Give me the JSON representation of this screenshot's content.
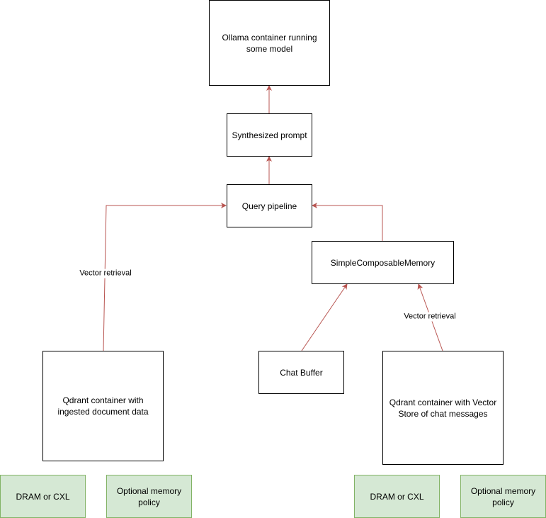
{
  "nodes": {
    "ollama": "Ollama container running some model",
    "synth": "Synthesized prompt",
    "query": "Query pipeline",
    "memory": "SimpleComposableMemory",
    "chat_buffer": "Chat Buffer",
    "qdrant_docs": "Qdrant container with ingested document data",
    "qdrant_chat": "Qdrant container with Vector Store of chat messages",
    "dram_left": "DRAM or CXL",
    "policy_left": "Optional memory policy",
    "dram_right": "DRAM or CXL",
    "policy_right": "Optional memory policy"
  },
  "edge_labels": {
    "docs_retrieval": "Vector retrieval",
    "chat_retrieval": "Vector retrieval"
  },
  "colors": {
    "edge": "#b85450",
    "green_fill": "#d5e8d4",
    "green_stroke": "#82b366"
  }
}
